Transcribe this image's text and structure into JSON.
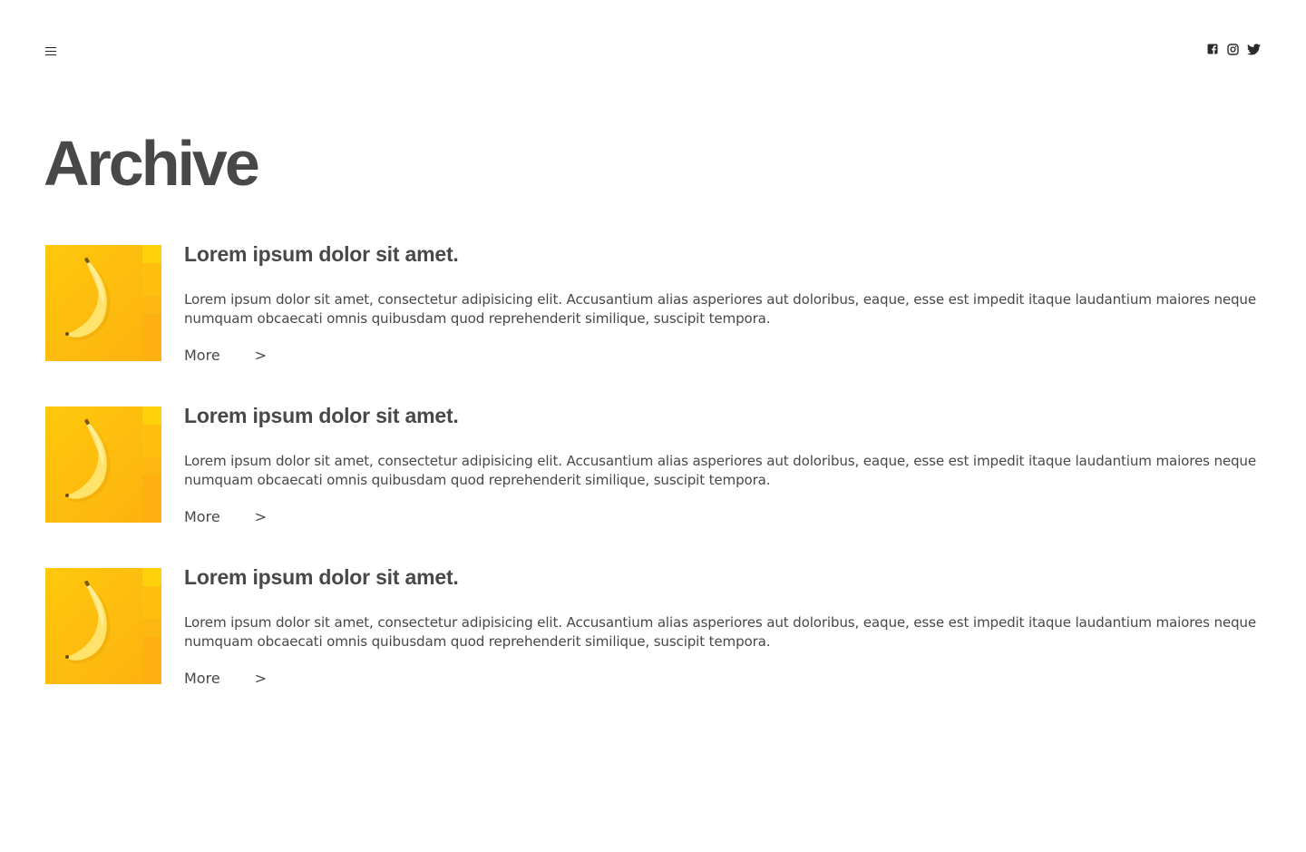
{
  "header": {
    "menu_icon": "hamburger-menu-icon",
    "social": [
      {
        "name": "facebook",
        "icon": "facebook-icon"
      },
      {
        "name": "instagram",
        "icon": "instagram-icon"
      },
      {
        "name": "twitter",
        "icon": "twitter-icon"
      }
    ]
  },
  "page": {
    "title": "Archive"
  },
  "colors": {
    "text": "#484848",
    "thumb_bg": "#fdc20d",
    "banana": "#ffe36a"
  },
  "posts": [
    {
      "title": "Lorem ipsum dolor sit amet.",
      "excerpt": "Lorem ipsum dolor sit amet, consectetur adipisicing elit. Accusantium alias asperiores aut doloribus, eaque, esse est impedit itaque laudantium maiores neque numquam obcaecati omnis quibusdam quod reprehenderit similique, suscipit tempora.",
      "more_label": "More",
      "more_arrow": ">",
      "image_icon": "banana-image"
    },
    {
      "title": "Lorem ipsum dolor sit amet.",
      "excerpt": "Lorem ipsum dolor sit amet, consectetur adipisicing elit. Accusantium alias asperiores aut doloribus, eaque, esse est impedit itaque laudantium maiores neque numquam obcaecati omnis quibusdam quod reprehenderit similique, suscipit tempora.",
      "more_label": "More",
      "more_arrow": ">",
      "image_icon": "banana-image"
    },
    {
      "title": "Lorem ipsum dolor sit amet.",
      "excerpt": "Lorem ipsum dolor sit amet, consectetur adipisicing elit. Accusantium alias asperiores aut doloribus, eaque, esse est impedit itaque laudantium maiores neque numquam obcaecati omnis quibusdam quod reprehenderit similique, suscipit tempora.",
      "more_label": "More",
      "more_arrow": ">",
      "image_icon": "banana-image"
    }
  ]
}
